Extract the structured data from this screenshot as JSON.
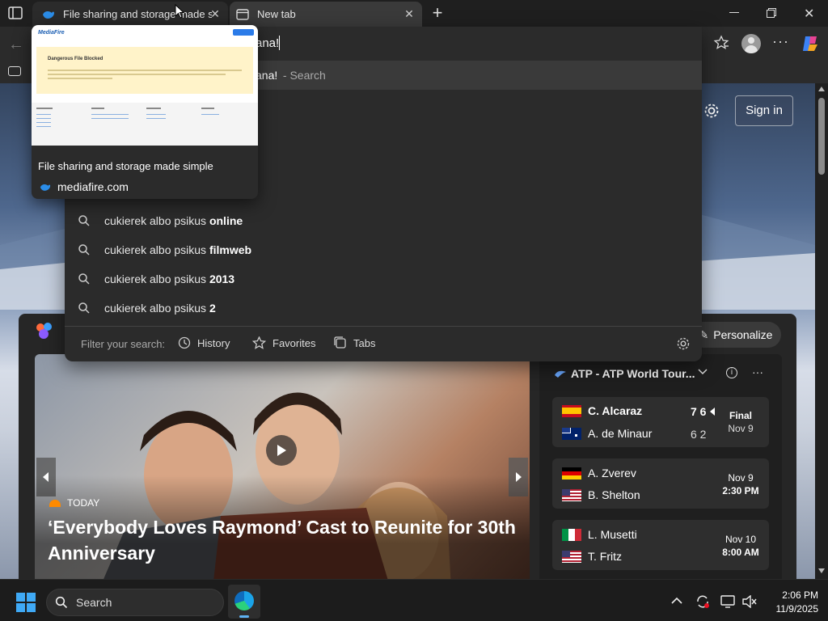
{
  "tabs": [
    {
      "title": "File sharing and storage made simple",
      "icon": "mediafire-icon",
      "active": true
    },
    {
      "title": "New tab",
      "icon": "newtab-icon",
      "active": false
    }
  ],
  "address": {
    "value": "ana!"
  },
  "dropdown": {
    "top_suggestion": {
      "text": "ana!",
      "suffix": " - Search"
    },
    "suggestions": [
      {
        "prefix": "cukierek albo psikus ",
        "bold": "online"
      },
      {
        "prefix": "cukierek albo psikus ",
        "bold": "filmweb"
      },
      {
        "prefix": "cukierek albo psikus ",
        "bold": "2013"
      },
      {
        "prefix": "cukierek albo psikus ",
        "bold": "2"
      }
    ],
    "filter_label": "Filter your search:",
    "filters": [
      "History",
      "Favorites",
      "Tabs"
    ]
  },
  "preview": {
    "thumb_logo": "MediaFire",
    "thumb_heading": "Dangerous File Blocked",
    "page_title": "File sharing and storage made simple",
    "domain": "mediafire.com"
  },
  "newtab": {
    "sign_in": "Sign in",
    "personalize": "Personalize",
    "hero_tag": "TODAY",
    "hero_title": "‘Everybody Loves Raymond’ Cast to Reunite for 30th Anniversary"
  },
  "sports": {
    "title": "ATP - ATP World Tour...",
    "matches": [
      {
        "p1": "C. Alcaraz",
        "p2": "A. de Minaur",
        "s1": "7 6",
        "s2": "6 2",
        "status": "Final",
        "date": "Nov 9",
        "f1": [
          "#c60b1e",
          "#ffc400",
          "#c60b1e"
        ],
        "f2": [
          "#012169",
          "#012169",
          "#012169"
        ]
      },
      {
        "p1": "A. Zverev",
        "p2": "B. Shelton",
        "s1": "",
        "s2": "",
        "status": "Nov 9",
        "date": "2:30 PM",
        "f1": [
          "#000000",
          "#dd0000",
          "#ffce00"
        ],
        "f2": [
          "#b22234",
          "#ffffff",
          "#b22234"
        ]
      },
      {
        "p1": "L. Musetti",
        "p2": "T. Fritz",
        "s1": "",
        "s2": "",
        "status": "Nov 10",
        "date": "8:00 AM",
        "f1": [
          "#009246",
          "#ffffff",
          "#ce2b37"
        ],
        "f2": [
          "#b22234",
          "#ffffff",
          "#b22234"
        ]
      }
    ]
  },
  "taskbar": {
    "search_placeholder": "Search",
    "time": "2:06 PM",
    "date": "11/9/2025"
  }
}
